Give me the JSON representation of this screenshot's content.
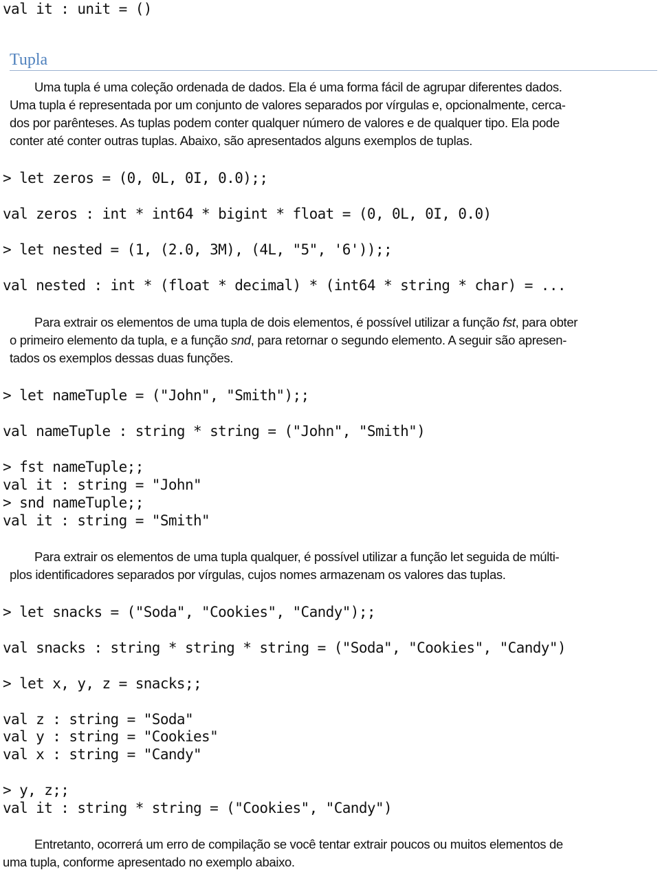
{
  "document": {
    "top_code": "val it : unit = ()",
    "section_title": "Tupla",
    "para1": {
      "lines": [
        "Uma tupla é uma coleção ordenada de dados. Ela é uma forma fácil de agrupar diferentes dados.",
        "Uma tupla é representada por um conjunto de valores separados por vírgulas e, opcionalmente, cerca-",
        "dos por parênteses. As tuplas podem conter qualquer número de valores e de qualquer tipo. Ela pode",
        "conter até conter outras tuplas. Abaixo, são apresentados alguns exemplos de tuplas."
      ]
    },
    "code1": [
      "> let zeros = (0, 0L, 0I, 0.0);;",
      "val zeros : int * int64 * bigint * float = (0, 0L, 0I, 0.0)",
      "> let nested = (1, (2.0, 3M), (4L, \"5\", '6'));;",
      "val nested : int * (float * decimal) * (int64 * string * char) = ..."
    ],
    "para2": {
      "line1_before": "Para extrair os elementos de uma tupla de dois elementos, é possível utilizar a função ",
      "line1_fn": "fst",
      "line1_after": ", para obter",
      "line2_before": "o primeiro elemento da tupla, e a função ",
      "line2_fn": "snd",
      "line2_after": ", para retornar o segundo elemento. A seguir são apresen-",
      "line3": "tados os exemplos dessas duas funções."
    },
    "code2": [
      "> let nameTuple = (\"John\", \"Smith\");;",
      "val nameTuple : string * string = (\"John\", \"Smith\")",
      "> fst nameTuple;;",
      "val it : string = \"John\"",
      "> snd nameTuple;;",
      "val it : string = \"Smith\""
    ],
    "para3": {
      "lines": [
        "Para extrair os elementos de uma tupla qualquer, é possível utilizar a função let seguida de múlti-",
        "plos identificadores separados por vírgulas, cujos nomes armazenam os valores das tuplas."
      ]
    },
    "code3": [
      "> let snacks = (\"Soda\", \"Cookies\", \"Candy\");;",
      "val snacks : string * string * string = (\"Soda\", \"Cookies\", \"Candy\")",
      "> let x, y, z = snacks;;",
      "val z : string = \"Soda\"",
      "val y : string = \"Cookies\"",
      "val x : string = \"Candy\"",
      "> y, z;;",
      "val it : string * string = (\"Cookies\", \"Candy\")"
    ],
    "para4": {
      "lines": [
        "Entretanto, ocorrerá um erro de compilação se você tentar extrair poucos ou muitos elementos de",
        "uma tupla, conforme apresentado no exemplo abaixo."
      ]
    },
    "colors": {
      "heading": "#4f81bd",
      "heading_rule": "#9bb2d0",
      "text": "#111111"
    }
  }
}
